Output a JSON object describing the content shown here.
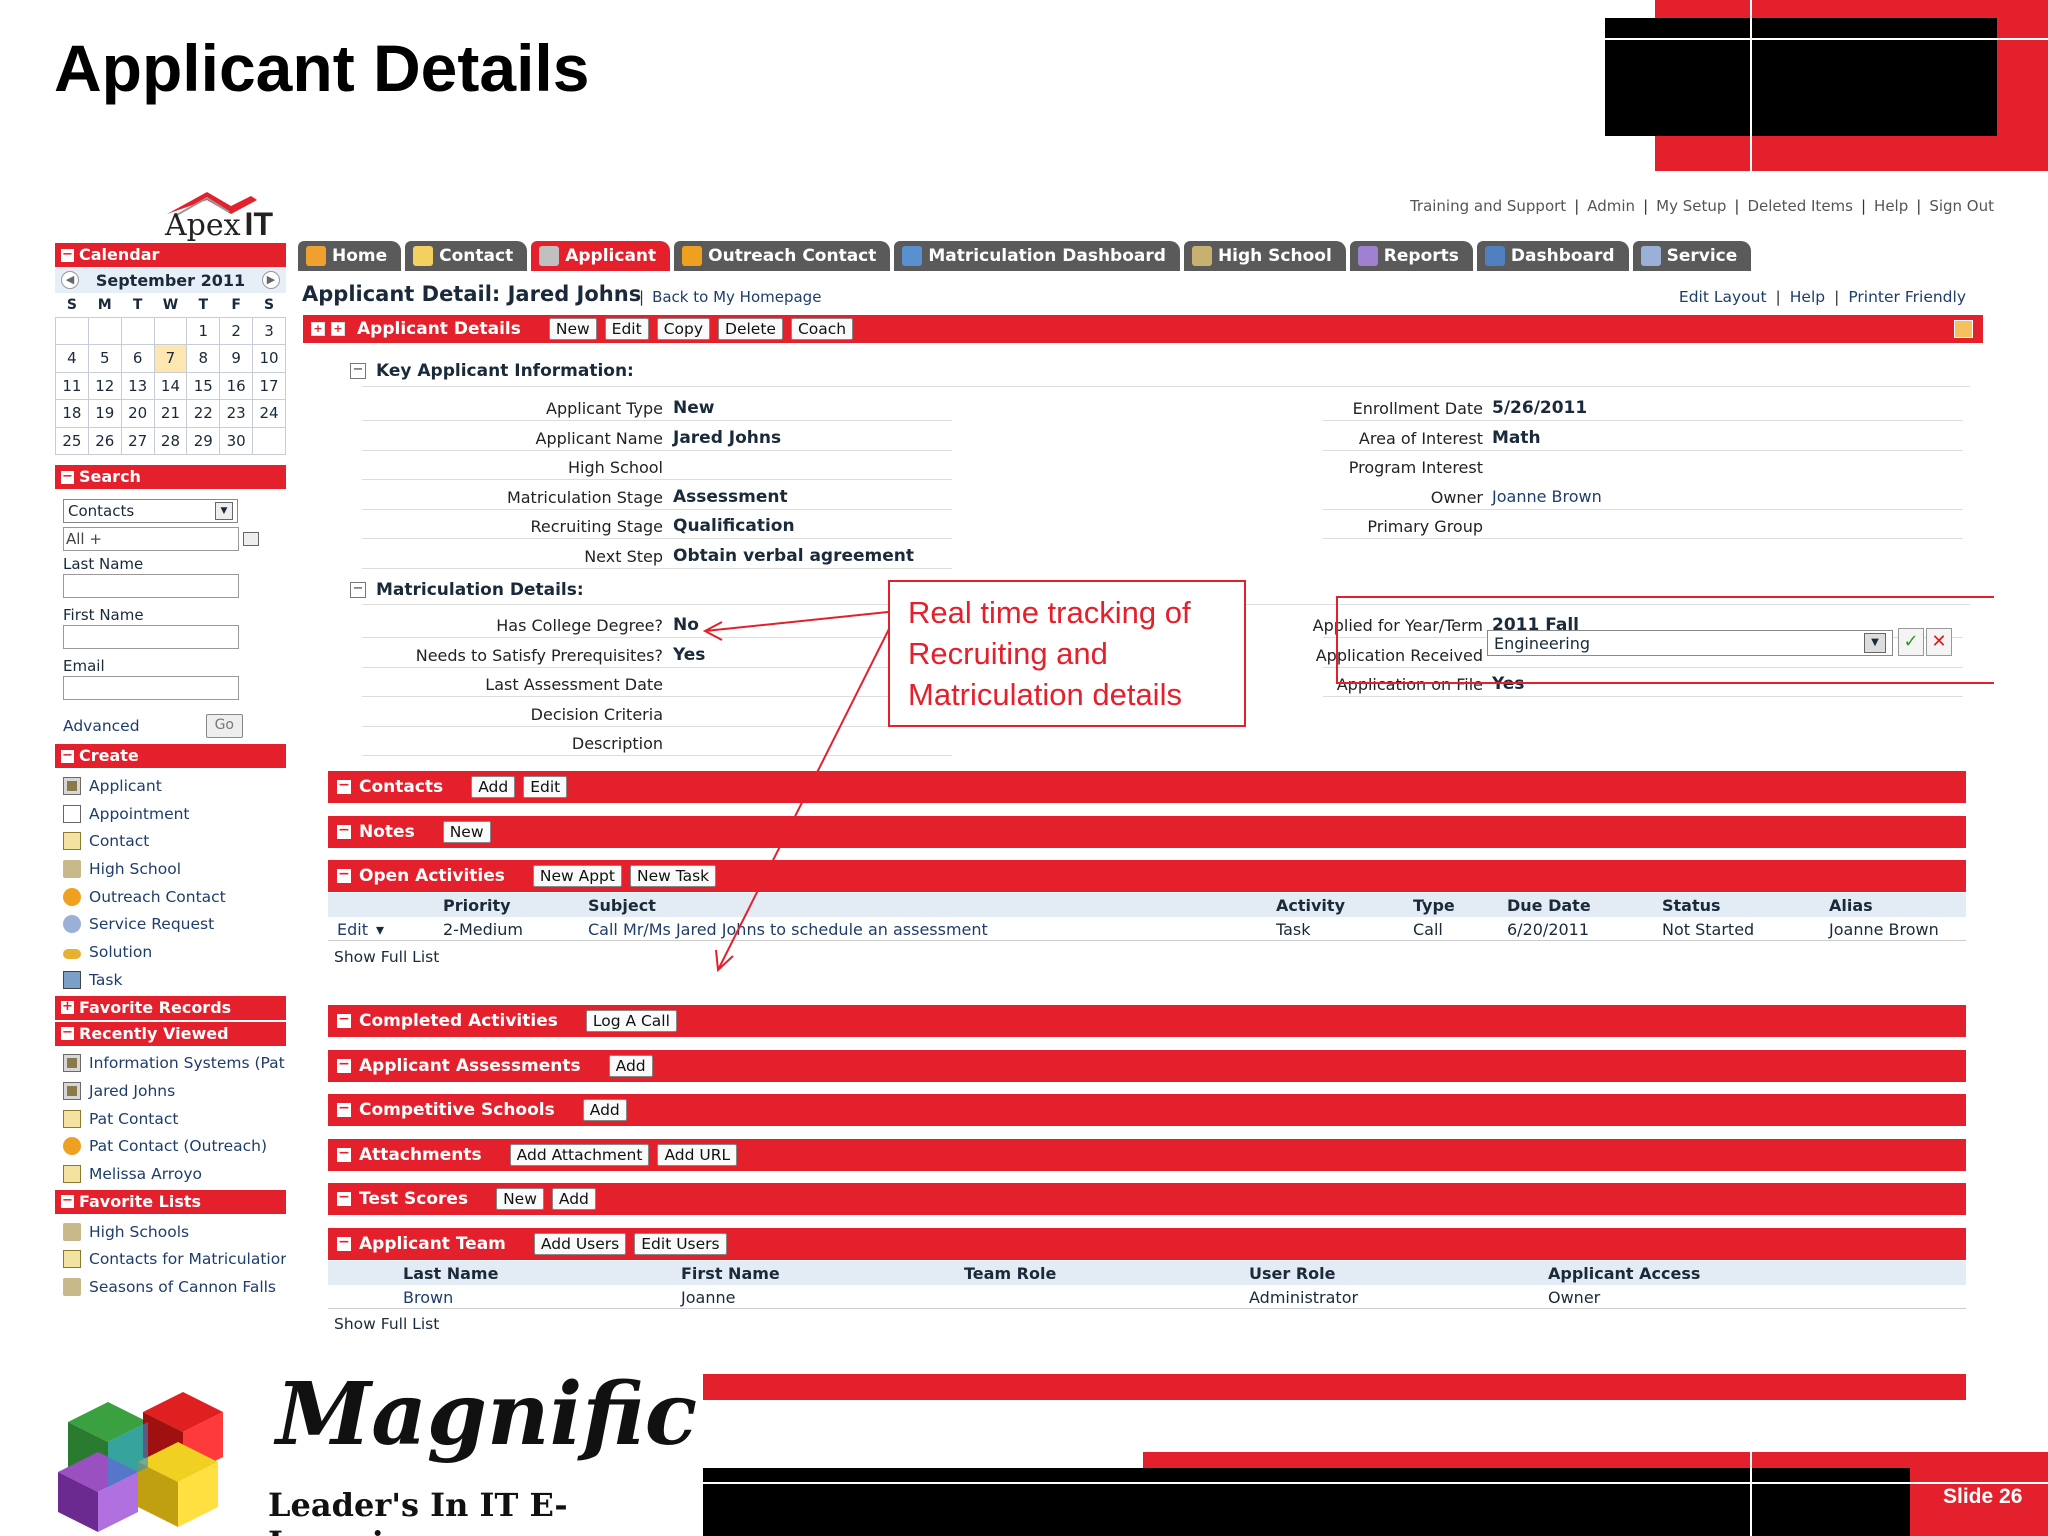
{
  "slide": {
    "title": "Applicant Details",
    "number": "Slide 26",
    "callout": [
      "Real time tracking of",
      "Recruiting and",
      "Matriculation details"
    ]
  },
  "branding": {
    "app_logo_prefix": "Apex",
    "app_logo_suffix": "IT",
    "footer_brand": "Magnific",
    "footer_tagline": "Leader's In IT E-Learning"
  },
  "colors": {
    "accent": "#e4202c",
    "tab_inactive": "#5a5a5a",
    "link": "#1f3d6b",
    "table_header": "#e3ecf5"
  },
  "top_links": [
    "Training and Support",
    "Admin",
    "My Setup",
    "Deleted Items",
    "Help",
    "Sign Out"
  ],
  "sidebar": {
    "calendar": {
      "header": "Calendar",
      "month": "September 2011",
      "prev_icon": "prev-arrow-icon",
      "next_icon": "next-arrow-icon",
      "weekdays": [
        "S",
        "M",
        "T",
        "W",
        "T",
        "F",
        "S"
      ],
      "weeks": [
        [
          "",
          "",
          "",
          "",
          "1",
          "2",
          "3"
        ],
        [
          "4",
          "5",
          "6",
          "7",
          "8",
          "9",
          "10"
        ],
        [
          "11",
          "12",
          "13",
          "14",
          "15",
          "16",
          "17"
        ],
        [
          "18",
          "19",
          "20",
          "21",
          "22",
          "23",
          "24"
        ],
        [
          "25",
          "26",
          "27",
          "28",
          "29",
          "30",
          ""
        ]
      ],
      "today": "7"
    },
    "search": {
      "header": "Search",
      "type_value": "Contacts",
      "scope_value": "All +",
      "last_name_label": "Last Name",
      "first_name_label": "First Name",
      "email_label": "Email",
      "advanced_label": "Advanced",
      "go_label": "Go"
    },
    "create": {
      "header": "Create",
      "items": [
        {
          "label": "Applicant",
          "icon": "applicant-icon"
        },
        {
          "label": "Appointment",
          "icon": "appointment-icon"
        },
        {
          "label": "Contact",
          "icon": "contact-icon"
        },
        {
          "label": "High School",
          "icon": "high-school-icon"
        },
        {
          "label": "Outreach Contact",
          "icon": "outreach-contact-icon"
        },
        {
          "label": "Service Request",
          "icon": "service-request-icon"
        },
        {
          "label": "Solution",
          "icon": "solution-icon"
        },
        {
          "label": "Task",
          "icon": "task-icon"
        }
      ]
    },
    "favorite_records_header": "Favorite Records",
    "recently_viewed": {
      "header": "Recently Viewed",
      "items": [
        {
          "label": "Information Systems (Pat",
          "icon": "applicant-icon"
        },
        {
          "label": "Jared Johns",
          "icon": "applicant-icon"
        },
        {
          "label": "Pat Contact",
          "icon": "contact-icon"
        },
        {
          "label": "Pat Contact (Outreach)",
          "icon": "outreach-contact-icon"
        },
        {
          "label": "Melissa Arroyo",
          "icon": "contact-icon"
        }
      ]
    },
    "favorite_lists": {
      "header": "Favorite Lists",
      "items": [
        {
          "label": "High Schools",
          "icon": "high-school-icon"
        },
        {
          "label": "Contacts for Matriculatior",
          "icon": "contact-icon"
        },
        {
          "label": "Seasons of Cannon Falls",
          "icon": "high-school-icon"
        }
      ]
    }
  },
  "tabs": [
    {
      "label": "Home",
      "icon": "home-icon",
      "active": false
    },
    {
      "label": "Contact",
      "icon": "contact-icon",
      "active": false
    },
    {
      "label": "Applicant",
      "icon": "applicant-icon",
      "active": true
    },
    {
      "label": "Outreach Contact",
      "icon": "outreach-contact-icon",
      "active": false
    },
    {
      "label": "Matriculation Dashboard",
      "icon": "chart-icon",
      "active": false
    },
    {
      "label": "High School",
      "icon": "high-school-icon",
      "active": false
    },
    {
      "label": "Reports",
      "icon": "reports-icon",
      "active": false
    },
    {
      "label": "Dashboard",
      "icon": "dashboard-icon",
      "active": false
    },
    {
      "label": "Service",
      "icon": "service-icon",
      "active": false
    }
  ],
  "detail": {
    "title": "Applicant Detail: Jared Johns",
    "back_link": "Back to My Homepage",
    "right_links": [
      "Edit Layout",
      "Help",
      "Printer Friendly"
    ],
    "panel_title": "Applicant Details",
    "panel_buttons": [
      "New",
      "Edit",
      "Copy",
      "Delete",
      "Coach"
    ],
    "key_section": "Key Applicant Information:",
    "key_left": [
      {
        "label": "Applicant Type",
        "value": "New"
      },
      {
        "label": "Applicant Name",
        "value": "Jared Johns"
      },
      {
        "label": "High School",
        "value": ""
      },
      {
        "label": "Matriculation Stage",
        "value": "Assessment"
      },
      {
        "label": "Recruiting Stage",
        "value": "Qualification"
      },
      {
        "label": "Next Step",
        "value": "Obtain verbal agreement"
      }
    ],
    "key_right": [
      {
        "label": "Enrollment Date",
        "value": "5/26/2011"
      },
      {
        "label": "Area of Interest",
        "value": "Math"
      },
      {
        "label": "Program Interest",
        "value": "Engineering"
      },
      {
        "label": "Owner",
        "value": "Joanne Brown"
      },
      {
        "label": "Primary Group",
        "value": ""
      }
    ],
    "matric_section": "Matriculation Details:",
    "matric_left": [
      {
        "label": "Has College Degree?",
        "value": "No"
      },
      {
        "label": "Needs to Satisfy Prerequisites?",
        "value": "Yes"
      },
      {
        "label": "Last Assessment Date",
        "value": ""
      },
      {
        "label": "Decision Criteria",
        "value": ""
      },
      {
        "label": "Description",
        "value": ""
      }
    ],
    "matric_right": [
      {
        "label": "Applied for Year/Term",
        "value": "2011 Fall"
      },
      {
        "label": "Application Received",
        "value": ""
      },
      {
        "label": "Application on File",
        "value": "Yes"
      }
    ]
  },
  "related": {
    "contacts": {
      "title": "Contacts",
      "buttons": [
        "Add",
        "Edit"
      ]
    },
    "notes": {
      "title": "Notes",
      "buttons": [
        "New"
      ]
    },
    "open_activities": {
      "title": "Open Activities",
      "buttons": [
        "New Appt",
        "New Task"
      ],
      "columns": [
        "Priority",
        "Subject",
        "Activity",
        "Type",
        "Due Date",
        "Status",
        "Alias"
      ],
      "rows": [
        {
          "action": "Edit",
          "priority": "2-Medium",
          "subject": "Call Mr/Ms Jared Johns to schedule an assessment",
          "activity": "Task",
          "type": "Call",
          "due": "6/20/2011",
          "status": "Not Started",
          "alias": "Joanne Brown"
        }
      ],
      "show_full": "Show Full List"
    },
    "completed_activities": {
      "title": "Completed Activities",
      "buttons": [
        "Log A Call"
      ]
    },
    "assessments": {
      "title": "Applicant Assessments",
      "buttons": [
        "Add"
      ]
    },
    "competitive": {
      "title": "Competitive Schools",
      "buttons": [
        "Add"
      ]
    },
    "attachments": {
      "title": "Attachments",
      "buttons": [
        "Add Attachment",
        "Add URL"
      ]
    },
    "test_scores": {
      "title": "Test Scores",
      "buttons": [
        "New",
        "Add"
      ]
    },
    "team": {
      "title": "Applicant Team",
      "buttons": [
        "Add Users",
        "Edit Users"
      ],
      "columns": [
        "Last Name",
        "First Name",
        "Team Role",
        "User Role",
        "Applicant Access"
      ],
      "rows": [
        {
          "last": "Brown",
          "first": "Joanne",
          "team_role": "",
          "user_role": "Administrator",
          "access": "Owner"
        }
      ],
      "show_full": "Show Full List"
    }
  }
}
